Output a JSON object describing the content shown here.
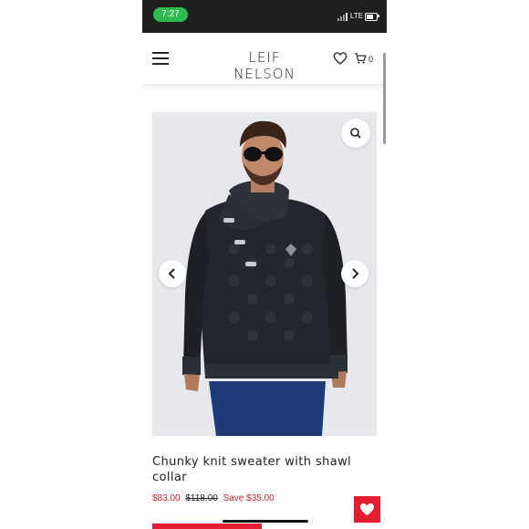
{
  "status_bar": {
    "time": "7:27",
    "network": "LTE"
  },
  "header": {
    "logo": "LEIF NELSON",
    "cart_count": "0",
    "icons": [
      "menu-icon",
      "heart-icon",
      "cart-icon"
    ]
  },
  "gallery": {
    "image": "man in black chunky knit shawl collar sweater and sunglasses",
    "icons": [
      "zoom-icon",
      "chevron-left-icon",
      "chevron-right-icon"
    ]
  },
  "product": {
    "title": "Chunky knit sweater with shawl collar",
    "sale_price": "$83.00",
    "original_price": "$118.00",
    "savings": "Save $35.00"
  },
  "colors": {
    "accent": "#e41d33",
    "sale_text": "#c8202f",
    "status_pill": "#2dbb4e"
  }
}
